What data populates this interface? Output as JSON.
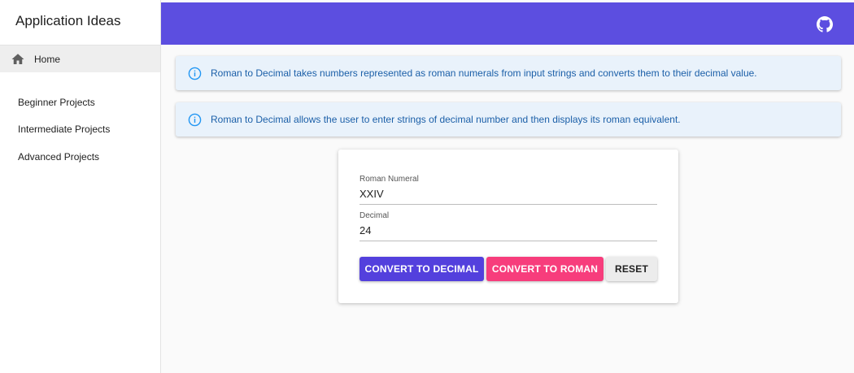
{
  "sidebar": {
    "title": "Application Ideas",
    "home_label": "Home",
    "items": [
      {
        "label": "Beginner Projects"
      },
      {
        "label": "Intermediate Projects"
      },
      {
        "label": "Advanced Projects"
      }
    ]
  },
  "topbar": {
    "color": "#5c4ee0",
    "icon": "github-icon"
  },
  "alerts": [
    {
      "text": "Roman to Decimal takes numbers represented as roman numerals from input strings and converts them to their decimal value.",
      "icon": "info-icon"
    },
    {
      "text": "Roman to Decimal allows the user to enter strings of decimal number and then displays its roman equivalent.",
      "icon": "info-icon"
    }
  ],
  "form": {
    "roman_label": "Roman Numeral",
    "roman_value": "XXIV",
    "decimal_label": "Decimal",
    "decimal_value": "24",
    "convert_decimal_label": "CONVERT TO DECIMAL",
    "convert_roman_label": "CONVERT TO ROMAN",
    "reset_label": "RESET"
  },
  "colors": {
    "primary": "#5340dd",
    "secondary": "#f73d7c",
    "alert_text": "#1b5fa8",
    "alert_bg": "#e9f2fb"
  }
}
